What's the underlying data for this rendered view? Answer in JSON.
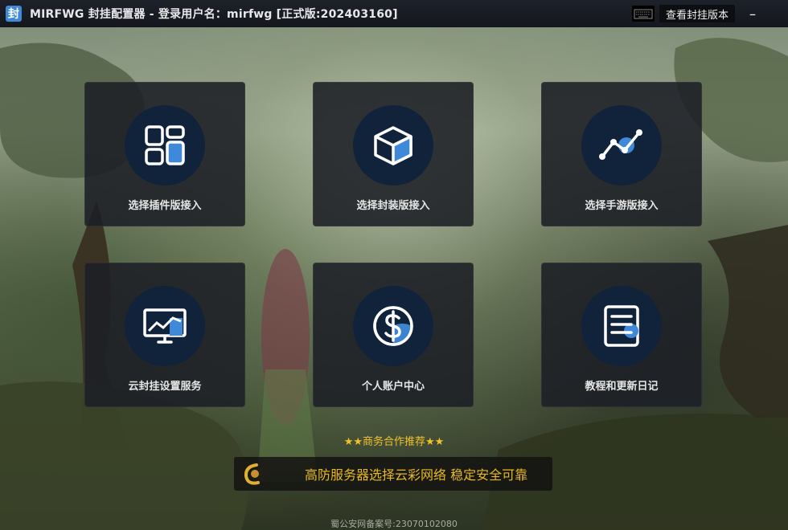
{
  "window": {
    "app_icon_char": "封",
    "title": "MIRFWG 封挂配置器 - 登录用户名：mirfwg   [正式版:202403160]",
    "view_version_button": "查看封挂版本",
    "close_char": "–"
  },
  "menu": [
    {
      "label": "选择插件版接入",
      "icon": "widgets-icon"
    },
    {
      "label": "选择封装版接入",
      "icon": "cube-icon"
    },
    {
      "label": "选择手游版接入",
      "icon": "line-chart-icon"
    },
    {
      "label": "云封挂设置服务",
      "icon": "monitor-chart-icon"
    },
    {
      "label": "个人账户中心",
      "icon": "dollar-icon"
    },
    {
      "label": "教程和更新日记",
      "icon": "document-icon"
    }
  ],
  "recommend": {
    "title": "★★商务合作推荐★★",
    "logo_text": "云彩",
    "banner_text": "高防服务器选择云彩网络   稳定安全可靠"
  },
  "footer": {
    "text": "蜀公安网备案号:23070102080"
  },
  "colors": {
    "accent": "#3f89d8",
    "icon_bg": "#10233a",
    "card_bg": "#1c1f26",
    "banner_text": "#e8b820",
    "recommend_text": "#f2c12e"
  }
}
